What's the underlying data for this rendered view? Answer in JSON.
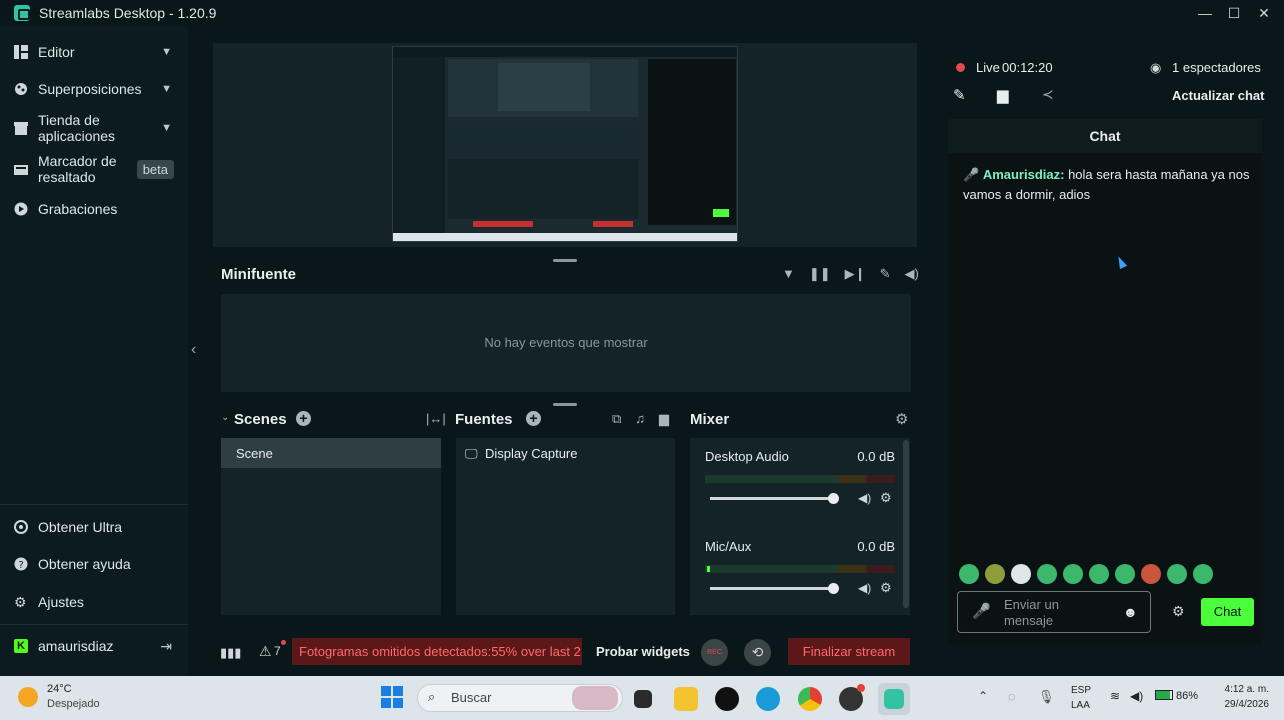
{
  "window": {
    "title": "Streamlabs Desktop - 1.20.9"
  },
  "sidebar": {
    "items": [
      {
        "label": "Editor",
        "icon": "editor-icon",
        "expand": true
      },
      {
        "label": "Superposiciones",
        "icon": "themes-icon",
        "expand": true
      },
      {
        "label": "Tienda de aplicaciones",
        "icon": "store-icon",
        "expand": true
      },
      {
        "label": "Marcador de resaltado",
        "icon": "highlighter-icon",
        "badge": "beta"
      },
      {
        "label": "Grabaciones",
        "icon": "recordings-icon"
      }
    ],
    "bottom_items": [
      {
        "label": "Obtener Ultra",
        "icon": "ultra-icon"
      },
      {
        "label": "Obtener ayuda",
        "icon": "help-icon"
      },
      {
        "label": "Ajustes",
        "icon": "settings-gear-icon"
      }
    ],
    "user": {
      "name": "amaurisdiaz",
      "icon": "kick-logo-icon"
    }
  },
  "minifuente": {
    "title": "Minifuente",
    "empty": "No hay eventos que mostrar"
  },
  "scenes": {
    "title": "Scenes",
    "items": [
      "Scene"
    ]
  },
  "fuentes": {
    "title": "Fuentes",
    "items": [
      "Display Capture"
    ]
  },
  "mixer": {
    "title": "Mixer",
    "channels": [
      {
        "name": "Desktop Audio",
        "db": "0.0 dB",
        "level": 1.0
      },
      {
        "name": "Mic/Aux",
        "db": "0.0 dB",
        "level": 1.0
      }
    ]
  },
  "statusbar": {
    "warn_count": "7",
    "alert": "Fotogramas omitidos detectados:55% over last 2",
    "probar": "Probar widgets",
    "rec": "REC",
    "end_stream": "Finalizar stream"
  },
  "live": {
    "label": "Live",
    "time": "00:12:20",
    "viewers": "1 espectadores",
    "refresh": "Actualizar chat"
  },
  "chat": {
    "title": "Chat",
    "messages": [
      {
        "user": "Amaurisdiaz:",
        "text": " hola sera hasta mañana ya nos vamos a dormir, adios"
      }
    ],
    "placeholder": "Enviar un mensaje",
    "send": "Chat"
  },
  "taskbar": {
    "weather_temp": "24°C",
    "weather_desc": "Despejado",
    "search": "Buscar",
    "lang1": "ESP",
    "lang2": "LAA",
    "battery": "86%",
    "time": "4:12 a. m.",
    "date": "29/4/2026"
  },
  "colors": {
    "accent": "#31c3a2",
    "bg": "#09161a",
    "panel": "#142328",
    "alert": "#d63a3a",
    "send": "#4cff3b"
  }
}
